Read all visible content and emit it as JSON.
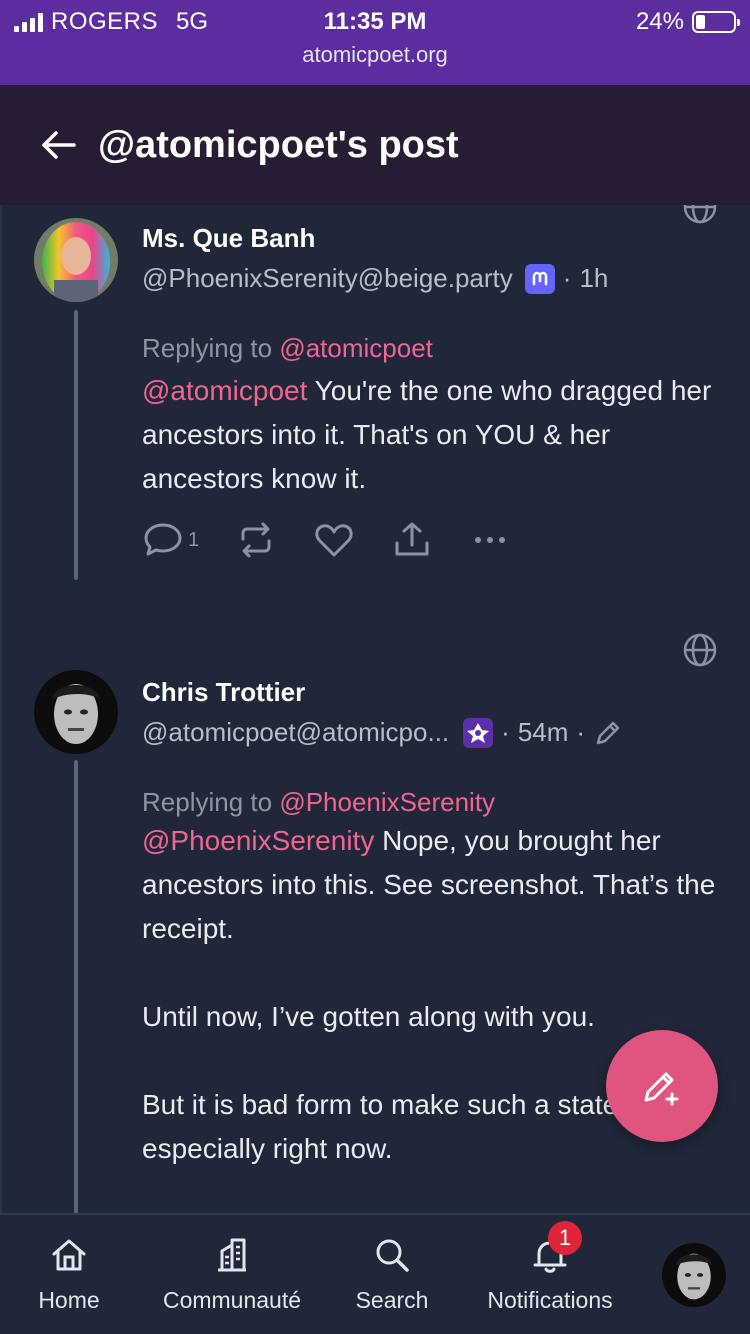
{
  "status_bar": {
    "carrier": "ROGERS",
    "network": "5G",
    "time": "11:35 PM",
    "url": "atomicpoet.org",
    "battery": "24%",
    "battery_level": 0.24
  },
  "header": {
    "back_icon": "arrow-left-icon",
    "title": "@atomicpoet's post"
  },
  "posts": [
    {
      "author": "Ms. Que Banh",
      "handle": "@PhoenixSerenity@beige.party",
      "badge_icon": "mastodon-icon",
      "time": "1h",
      "replying_label": "Replying to",
      "replying_to": "@atomicpoet",
      "mention": "@atomicpoet",
      "paragraphs": [
        "You're the one who dragged her ancestors into it. That's on YOU & her ancestors know it."
      ],
      "reply_count": "1"
    },
    {
      "author": "Chris Trottier",
      "handle": "@atomicpoet@atomicpo...",
      "badge_icon": "instance-icon",
      "time": "54m",
      "edited_icon": "pencil-icon",
      "replying_label": "Replying to",
      "replying_to": "@PhoenixSerenity",
      "mention": "@PhoenixSerenity",
      "paragraphs": [
        "Nope, you brought her ancestors into this. See screenshot. That’s the receipt.",
        "Until now, I’ve gotten along with you.",
        "But it is bad form to make such a statement, especially right now."
      ]
    }
  ],
  "nav": {
    "home": "Home",
    "community": "Communauté",
    "search": "Search",
    "notifications": "Notifications",
    "notifications_count": "1"
  },
  "colors": {
    "status_bar": "#5b2d9e",
    "header": "#271c33",
    "background": "#1f2739",
    "mention": "#f06593",
    "fab": "#e05480"
  }
}
